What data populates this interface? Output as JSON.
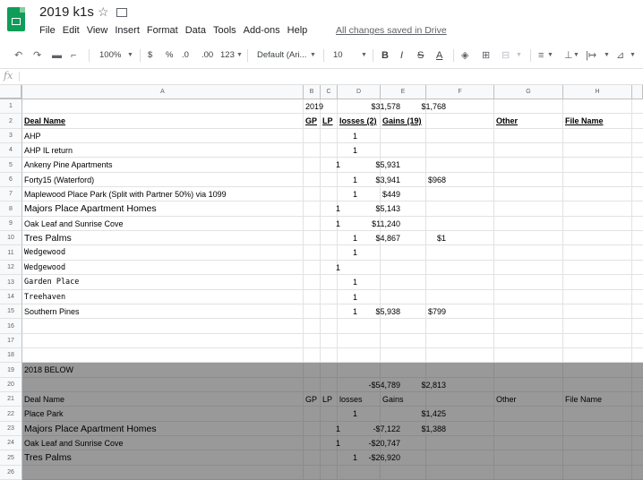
{
  "app": {
    "title": "2019 k1s",
    "menu": [
      "File",
      "Edit",
      "View",
      "Insert",
      "Format",
      "Data",
      "Tools",
      "Add-ons",
      "Help"
    ],
    "saved_status": "All changes saved in Drive"
  },
  "toolbar": {
    "zoom": "100%",
    "currency": "$",
    "percent": "%",
    "dec_decrease": ".0",
    "dec_increase": ".00",
    "more_formats": "123",
    "font": "Default (Ari...",
    "font_size": "10",
    "bold": "B",
    "italic": "I",
    "strike": "S",
    "text_color": "A"
  },
  "formula_bar": {
    "fx": "fx",
    "value": ""
  },
  "columns": [
    "A",
    "B",
    "C",
    "D",
    "E",
    "F",
    "G",
    "H"
  ],
  "rows": [
    {
      "n": "1",
      "A": "",
      "Ar": "2019",
      "B": "",
      "C": "",
      "D": "$31,578",
      "E": "$1,768",
      "G": "",
      "H": ""
    },
    {
      "n": "2",
      "A": "Deal Name",
      "B": "GP",
      "C": "LP",
      "D": "losses (2)",
      "E": "Gains (19)",
      "G": "Other",
      "H": "File Name",
      "bold": true
    },
    {
      "n": "3",
      "A": "AHP",
      "C": "1"
    },
    {
      "n": "4",
      "A": "AHP IL return",
      "C": "1"
    },
    {
      "n": "5",
      "A": "Ankeny Pine Apartments",
      "B": "1",
      "D": "$5,931"
    },
    {
      "n": "6",
      "A": "Forty15 (Waterford)",
      "C": "1",
      "D": "$3,941",
      "E": "$968"
    },
    {
      "n": "7",
      "A": "Maplewood Place Park (Split with Partner 50%) via 1099",
      "C": "1",
      "D": "$449"
    },
    {
      "n": "8",
      "A": "Majors Place Apartment Homes",
      "B": "1",
      "D": "$5,143",
      "big": true
    },
    {
      "n": "9",
      "A": "Oak Leaf and Sunrise Cove",
      "B": "1",
      "D": "$11,240"
    },
    {
      "n": "10",
      "A": "Tres Palms",
      "C": "1",
      "D": "$4,867",
      "E": "$1",
      "big": true
    },
    {
      "n": "11",
      "A": "Wedgewood",
      "C": "1",
      "mono": true
    },
    {
      "n": "12",
      "A": "Wedgewood",
      "B": "1",
      "mono": true
    },
    {
      "n": "13",
      "A": "Garden Place",
      "C": "1",
      "mono": true
    },
    {
      "n": "14",
      "A": "Treehaven",
      "C": "1",
      "mono": true
    },
    {
      "n": "15",
      "A": "Southern Pines",
      "C": "1",
      "D": "$5,938",
      "E": "$799"
    },
    {
      "n": "16"
    },
    {
      "n": "17"
    },
    {
      "n": "18"
    },
    {
      "n": "19",
      "A": "2018 BELOW",
      "dark": true
    },
    {
      "n": "20",
      "D": "-$54,789",
      "E": "$2,813",
      "dark": true
    },
    {
      "n": "21",
      "A": "Deal Name",
      "B": "GP",
      "C": "LP",
      "D": "losses",
      "E": "Gains",
      "G": "Other",
      "H": "File Name",
      "dark": true,
      "hdrplain": true
    },
    {
      "n": "22",
      "A": "Place Park",
      "C": "1",
      "E": "$1,425",
      "dark": true
    },
    {
      "n": "23",
      "A": "Majors Place Apartment Homes",
      "B": "1",
      "D": "-$7,122",
      "E": "$1,388",
      "dark": true,
      "big": true
    },
    {
      "n": "24",
      "A": "Oak Leaf and Sunrise Cove",
      "B": "1",
      "D": "-$20,747",
      "dark": true
    },
    {
      "n": "25",
      "A": "Tres Palms",
      "C": "1",
      "D": "-$26,920",
      "dark": true,
      "big": true
    },
    {
      "n": "26",
      "dark": true
    }
  ]
}
